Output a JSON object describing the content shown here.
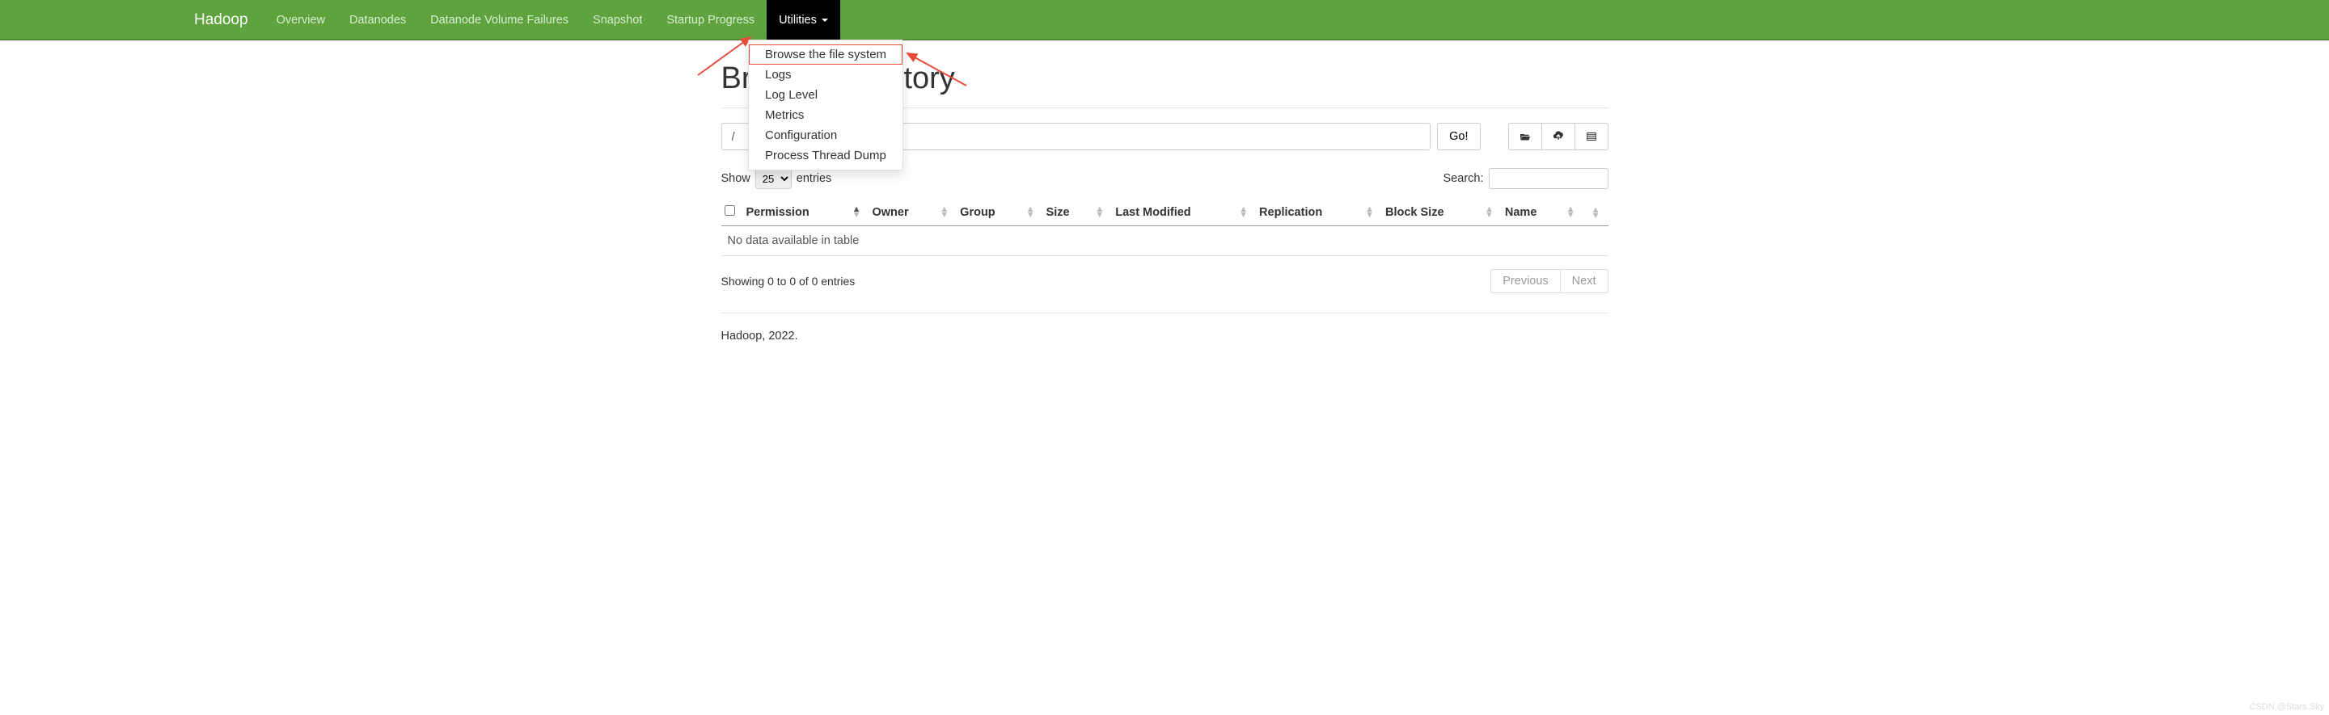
{
  "navbar": {
    "brand": "Hadoop",
    "items": [
      "Overview",
      "Datanodes",
      "Datanode Volume Failures",
      "Snapshot",
      "Startup Progress"
    ],
    "utilities_label": "Utilities"
  },
  "dropdown": {
    "items": [
      "Browse the file system",
      "Logs",
      "Log Level",
      "Metrics",
      "Configuration",
      "Process Thread Dump"
    ]
  },
  "page": {
    "title": "Browse Directory",
    "path_value": "/",
    "go_label": "Go!"
  },
  "entries": {
    "show_label": "Show",
    "entries_label": "entries",
    "selected": "25"
  },
  "search": {
    "label": "Search:"
  },
  "table": {
    "columns": [
      "Permission",
      "Owner",
      "Group",
      "Size",
      "Last Modified",
      "Replication",
      "Block Size",
      "Name"
    ],
    "empty_message": "No data available in table"
  },
  "info": {
    "text": "Showing 0 to 0 of 0 entries"
  },
  "pager": {
    "prev": "Previous",
    "next": "Next"
  },
  "footer": {
    "text": "Hadoop, 2022."
  },
  "watermark": "CSDN @Stars.Sky"
}
